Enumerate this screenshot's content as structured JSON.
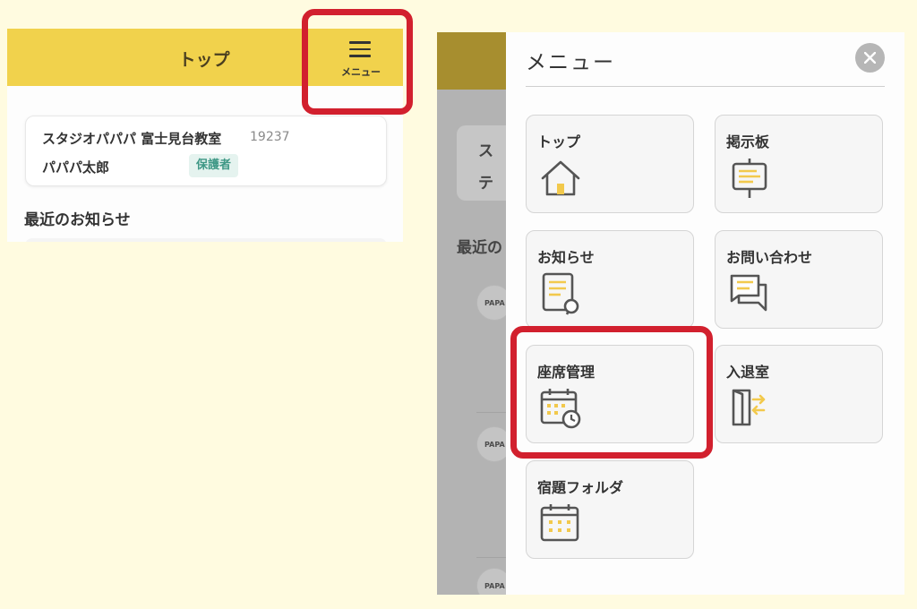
{
  "left_screen": {
    "header_title": "トップ",
    "menu_label": "メニュー",
    "school_name": "スタジオパパパ 富士見台教室",
    "school_id": "19237",
    "user_name": "パパパ太郎",
    "role_badge": "保護者",
    "news_heading": "最近のお知らせ"
  },
  "right_screen": {
    "background_fragments": [
      "ス",
      "テ",
      "最近の"
    ],
    "logo_text": "PAPA",
    "drawer": {
      "title": "メニュー",
      "close_icon": "close-icon",
      "items": [
        {
          "label": "トップ",
          "icon": "home-icon"
        },
        {
          "label": "掲示板",
          "icon": "board-icon"
        },
        {
          "label": "お知らせ",
          "icon": "notice-icon"
        },
        {
          "label": "お問い合わせ",
          "icon": "chat-icon"
        },
        {
          "label": "座席管理",
          "icon": "seat-calendar-icon"
        },
        {
          "label": "入退室",
          "icon": "entry-exit-icon"
        },
        {
          "label": "宿題フォルダ",
          "icon": "homework-calendar-icon"
        }
      ]
    }
  },
  "colors": {
    "page_background": "#fffbe0",
    "header_yellow": "#f1d24c",
    "icon_yellow": "#f2c94c",
    "icon_stroke": "#555555",
    "highlight_red": "#d2202e",
    "badge_bg": "#e5f3ef",
    "badge_text": "#3f9886"
  }
}
